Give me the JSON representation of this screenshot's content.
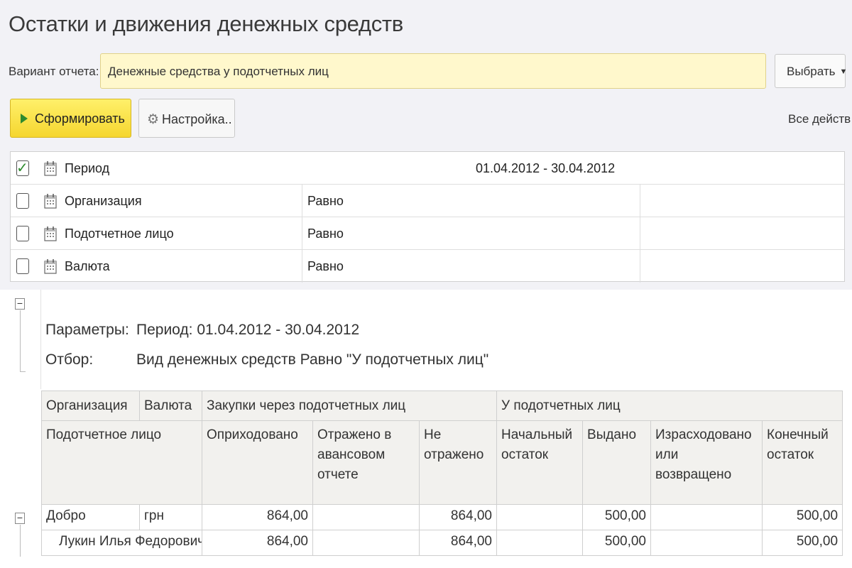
{
  "title": "Остатки и движения денежных средств",
  "variant": {
    "label": "Вариант отчета:",
    "value": "Денежные средства у подотчетных лиц",
    "select_label": "Выбрать"
  },
  "toolbar": {
    "generate_label": "Сформировать",
    "settings_label": "Настройка..",
    "all_actions_label": "Все действ"
  },
  "filters": [
    {
      "checked": true,
      "name": "Период",
      "condition": "",
      "value": "01.04.2012 - 30.04.2012"
    },
    {
      "checked": false,
      "name": "Организация",
      "condition": "Равно",
      "value": ""
    },
    {
      "checked": false,
      "name": "Подотчетное лицо",
      "condition": "Равно",
      "value": ""
    },
    {
      "checked": false,
      "name": "Валюта",
      "condition": "Равно",
      "value": ""
    }
  ],
  "report": {
    "params_label": "Параметры:",
    "params_value": "Период: 01.04.2012 - 30.04.2012",
    "filter_label": "Отбор:",
    "filter_value": "Вид денежных средств Равно \"У подотчетных лиц\"",
    "header_row1": {
      "organization": "Организация",
      "currency": "Валюта",
      "purchases_group": "Закупки через подотчетных лиц",
      "accountable_group": "У подотчетных лиц"
    },
    "header_row2": {
      "person": "Подотчетное лицо",
      "received": "Оприходовано",
      "reflected": "Отражено в авансовом отчете",
      "not_reflected": "Не отражено",
      "opening": "Начальный остаток",
      "issued": "Выдано",
      "spent": "Израсходовано или возвращено",
      "closing": "Конечный остаток"
    },
    "rows": [
      {
        "name": "Добро",
        "currency": "грн",
        "received": "864,00",
        "reflected": "",
        "not_reflected": "864,00",
        "opening": "",
        "issued": "500,00",
        "spent": "",
        "closing": "500,00"
      },
      {
        "name": "Лукин Илья Федорович",
        "currency": "",
        "received": "864,00",
        "reflected": "",
        "not_reflected": "864,00",
        "opening": "",
        "issued": "500,00",
        "spent": "",
        "closing": "500,00"
      }
    ]
  }
}
